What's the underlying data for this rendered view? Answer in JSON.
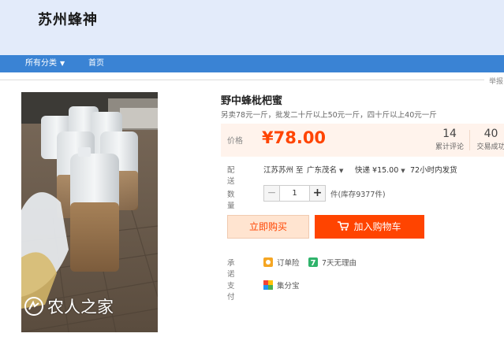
{
  "shop": {
    "name": "苏州蜂神"
  },
  "nav": {
    "categories_label": "所有分类",
    "home_label": "首页"
  },
  "report_label": "举报",
  "product": {
    "title": "野中蜂枇杷蜜",
    "subtitle": "另卖78元一斤，批发二十斤以上50元一斤，四十斤以上40元一斤",
    "image_alt": "product-photo-honey-jugs",
    "watermark_text": "农人之家"
  },
  "price": {
    "label": "价格",
    "value": "¥78.00"
  },
  "stats": {
    "reviews": {
      "count": "14",
      "label": "累计评论"
    },
    "sales": {
      "count": "40",
      "label": "交易成功"
    }
  },
  "shipping": {
    "label": "配送",
    "from": "江苏苏州 至",
    "to": "广东茂名",
    "express": "快递 ¥15.00",
    "dispatch": "72小时内发货"
  },
  "quantity": {
    "label": "数量",
    "minus": "−",
    "value": "1",
    "plus": "+",
    "unit_stock": "件(库存9377件)"
  },
  "buttons": {
    "buy_now": "立即购买",
    "add_to_cart": "加入购物车"
  },
  "promises": {
    "label": "承诺",
    "items": [
      {
        "icon": "order-insurance-icon",
        "text": "订单险"
      },
      {
        "icon": "seven-day-return-icon",
        "text": "7天无理由"
      }
    ]
  },
  "payment": {
    "label": "支付",
    "items": [
      {
        "icon": "jifenbao-icon",
        "text": "集分宝"
      }
    ]
  },
  "colors": {
    "header_bg": "#e3ebfa",
    "nav_bg": "#3a83d4",
    "accent": "#ff4400",
    "price_bg": "#fff3ec",
    "buy_now_bg": "#ffe4d0"
  }
}
